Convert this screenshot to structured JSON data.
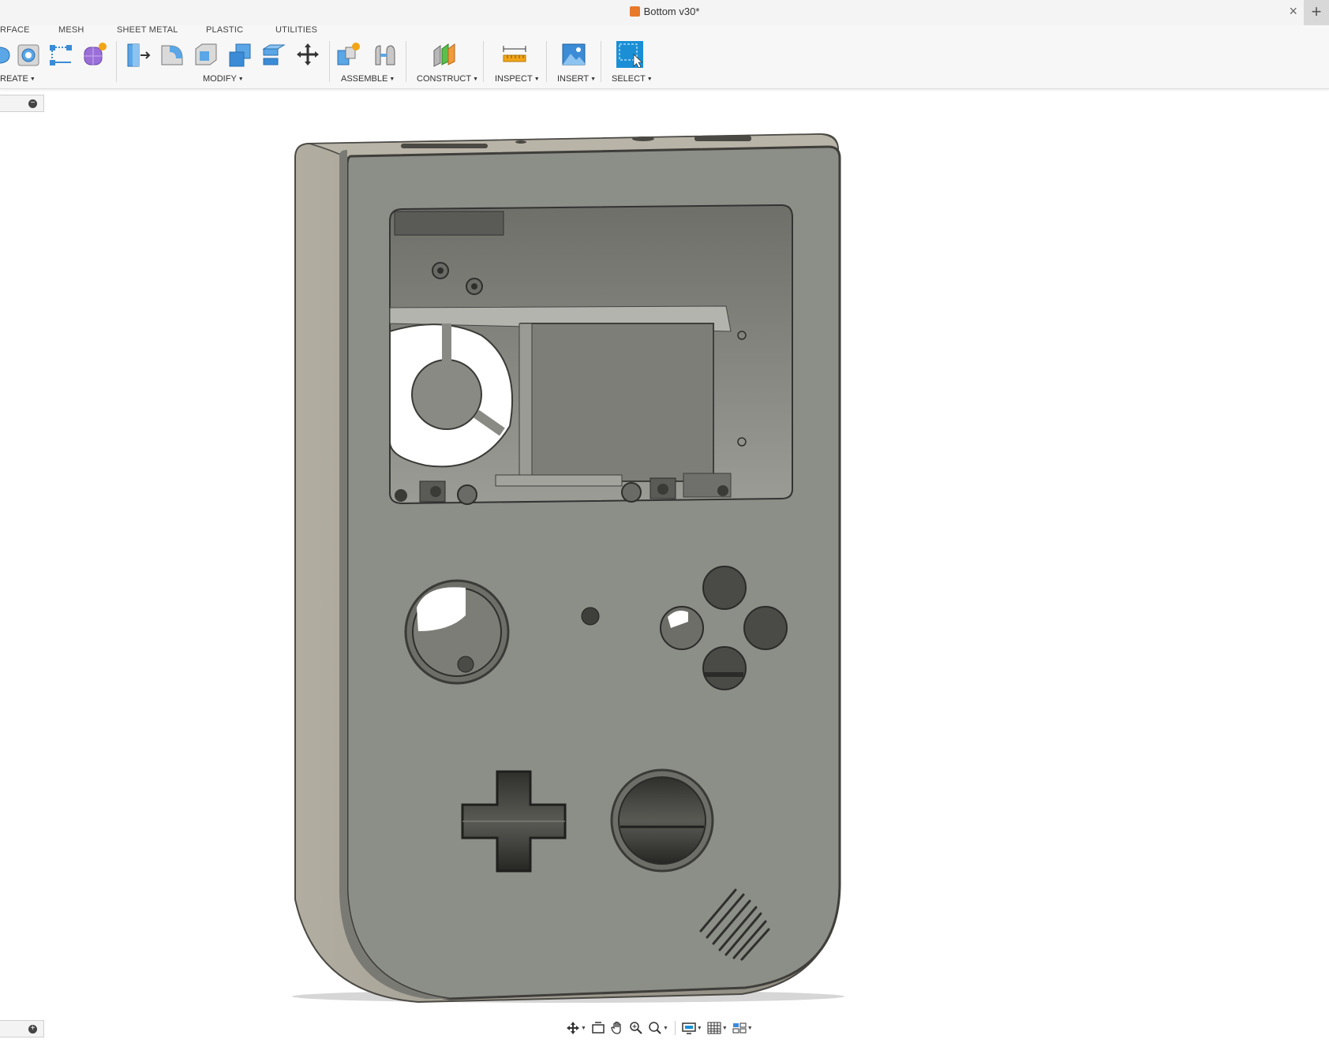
{
  "window": {
    "document_title": "Bottom v30*",
    "close_symbol": "×",
    "new_tab_symbol": "+"
  },
  "tabs": [
    {
      "label": "RFACE"
    },
    {
      "label": "MESH"
    },
    {
      "label": "SHEET METAL"
    },
    {
      "label": "PLASTIC"
    },
    {
      "label": "UTILITIES"
    }
  ],
  "groups": {
    "create": "REATE",
    "modify": "MODIFY",
    "assemble": "ASSEMBLE",
    "construct": "CONSTRUCT",
    "inspect": "INSPECT",
    "insert": "INSERT",
    "select": "SELECT"
  },
  "icons": {
    "create": [
      "revolve-icon",
      "hole-icon",
      "pattern-icon",
      "form-icon"
    ],
    "modify": [
      "press-pull-icon",
      "fillet-icon",
      "shell-icon",
      "combine-icon",
      "offset-face-icon",
      "move-copy-icon"
    ],
    "assemble": [
      "new-component-icon",
      "joint-icon"
    ],
    "construct": [
      "offset-plane-icon"
    ],
    "inspect": [
      "measure-icon"
    ],
    "insert": [
      "insert-image-icon"
    ],
    "select": [
      "window-select-icon"
    ],
    "navigation": [
      "orbit-icon",
      "look-at-icon",
      "pan-icon",
      "zoom-icon",
      "fit-icon",
      "display-settings-icon",
      "grid-settings-icon",
      "viewports-icon"
    ]
  },
  "panels": {
    "browser_toggle": "−",
    "comments_toggle": "+"
  },
  "colors": {
    "accent": "#1a8fd6",
    "body_gray": "#8c8e88",
    "body_side": "#a9a59a",
    "cavity_white": "#ffffff"
  }
}
